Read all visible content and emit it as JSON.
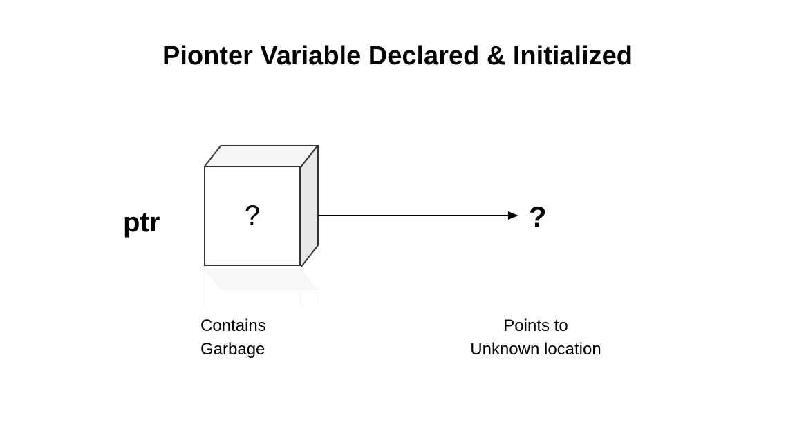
{
  "title": "Pionter Variable Declared & Initialized",
  "ptr_label": "ptr",
  "box_content": "?",
  "target_content": "?",
  "contains_line1": "Contains",
  "contains_line2": "Garbage",
  "points_line1": "Points to",
  "points_line2": "Unknown location"
}
